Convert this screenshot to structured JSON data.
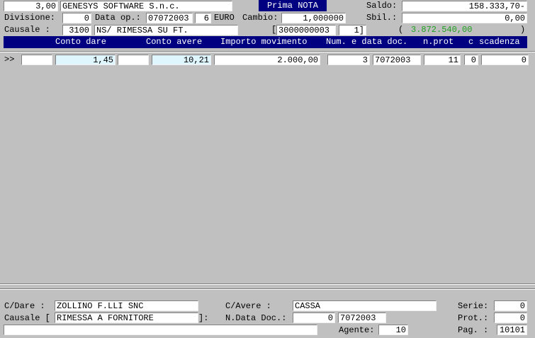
{
  "header": {
    "code": "3,00",
    "company": "GENESYS SOFTWARE S.n.c.",
    "title": "Prima NOTA",
    "saldo_label": "Saldo:",
    "saldo_value": "158.333,70-",
    "divisione_label": "Divisione:",
    "divisione_value": "0",
    "data_op_label": "Data op.:",
    "data_op_value": "07072003",
    "day_value": "6",
    "currency": "EURO",
    "cambio_label": "Cambio:",
    "cambio_value": "1,000000",
    "sbil_label": "Sbil.:",
    "sbil_value": "0,00",
    "causale_label": "Causale  :",
    "causale_code": "3100",
    "causale_desc": "NS/ RIMESSA SU FT.",
    "ref_open": "[",
    "ref_value": "3000000003",
    "ref_num": "1]",
    "total_open": "(",
    "total_value": "3.872.540,00",
    "total_close": ")"
  },
  "columns": {
    "conto_dare": "Conto dare",
    "conto_avere": "Conto avere",
    "importo": "Importo movimento",
    "num_data_doc": "Num. e data doc.",
    "nprot": "n.prot",
    "c": "c",
    "scadenza": "scadenza"
  },
  "row": {
    "marker": ">>",
    "dare_value": "1,45",
    "avere_value": "10,21",
    "importo_value": "2.000,00",
    "num_doc": "3",
    "data_doc": "7072003",
    "nprot_value": "11",
    "c_value": "0",
    "scadenza_value": "0"
  },
  "footer": {
    "cdare_label": "C/Dare  :",
    "cdare_value": "ZOLLINO F.LLI SNC",
    "cavere_label": "C/Avere    :",
    "cavere_value": "CASSA",
    "serie_label": "Serie:",
    "serie_value": "0",
    "causale_label": "Causale [",
    "causale_value": "RIMESSA A FORNITORE",
    "causale_close": "]:",
    "ndata_label": "N.Data Doc.:",
    "ndata_num": "0",
    "ndata_date": "7072003",
    "prot_label": "Prot.:",
    "prot_value": "0",
    "agente_label": "Agente:",
    "agente_value": "10",
    "pag_label": "Pag. :",
    "pag_value": "10101"
  }
}
